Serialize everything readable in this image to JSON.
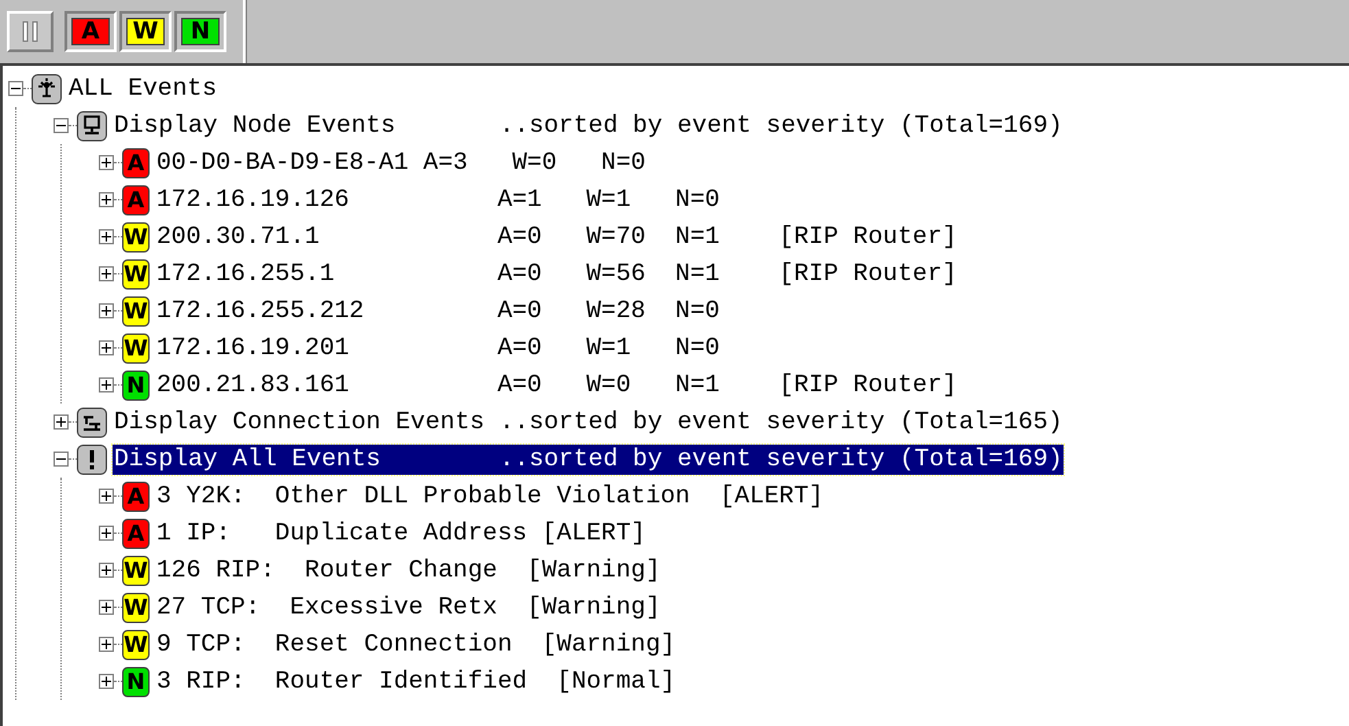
{
  "toolbar": {
    "filters": [
      {
        "letter": "A",
        "kind": "alert"
      },
      {
        "letter": "W",
        "kind": "warning"
      },
      {
        "letter": "N",
        "kind": "normal"
      }
    ]
  },
  "tree": {
    "label": "ALL Events",
    "kind": "root",
    "expanded": true,
    "selected": false,
    "children": [
      {
        "label": "Display Node Events       ..sorted by event severity (Total=169)",
        "kind": "nodes",
        "expanded": true,
        "selected": false,
        "children": [
          {
            "letter": "A",
            "kind": "alert",
            "label": "00-D0-BA-D9-E8-A1 A=3   W=0   N=0",
            "expanded": false
          },
          {
            "letter": "A",
            "kind": "alert",
            "label": "172.16.19.126          A=1   W=1   N=0",
            "expanded": false
          },
          {
            "letter": "W",
            "kind": "warning",
            "label": "200.30.71.1            A=0   W=70  N=1    [RIP Router]",
            "expanded": false
          },
          {
            "letter": "W",
            "kind": "warning",
            "label": "172.16.255.1           A=0   W=56  N=1    [RIP Router]",
            "expanded": false
          },
          {
            "letter": "W",
            "kind": "warning",
            "label": "172.16.255.212         A=0   W=28  N=0",
            "expanded": false
          },
          {
            "letter": "W",
            "kind": "warning",
            "label": "172.16.19.201          A=0   W=1   N=0",
            "expanded": false
          },
          {
            "letter": "N",
            "kind": "normal",
            "label": "200.21.83.161          A=0   W=0   N=1    [RIP Router]",
            "expanded": false
          }
        ]
      },
      {
        "label": "Display Connection Events ..sorted by event severity (Total=165)",
        "kind": "connections",
        "expanded": false,
        "selected": false
      },
      {
        "label": "Display All Events        ..sorted by event severity (Total=169)",
        "kind": "all",
        "expanded": true,
        "selected": true,
        "children": [
          {
            "letter": "A",
            "kind": "alert",
            "label": "3 Y2K:  Other DLL Probable Violation  [ALERT]",
            "expanded": false
          },
          {
            "letter": "A",
            "kind": "alert",
            "label": "1 IP:   Duplicate Address [ALERT]",
            "expanded": false
          },
          {
            "letter": "W",
            "kind": "warning",
            "label": "126 RIP:  Router Change  [Warning]",
            "expanded": false
          },
          {
            "letter": "W",
            "kind": "warning",
            "label": "27 TCP:  Excessive Retx  [Warning]",
            "expanded": false
          },
          {
            "letter": "W",
            "kind": "warning",
            "label": "9 TCP:  Reset Connection  [Warning]",
            "expanded": false
          },
          {
            "letter": "N",
            "kind": "normal",
            "label": "3 RIP:  Router Identified  [Normal]",
            "expanded": false
          }
        ]
      }
    ]
  }
}
